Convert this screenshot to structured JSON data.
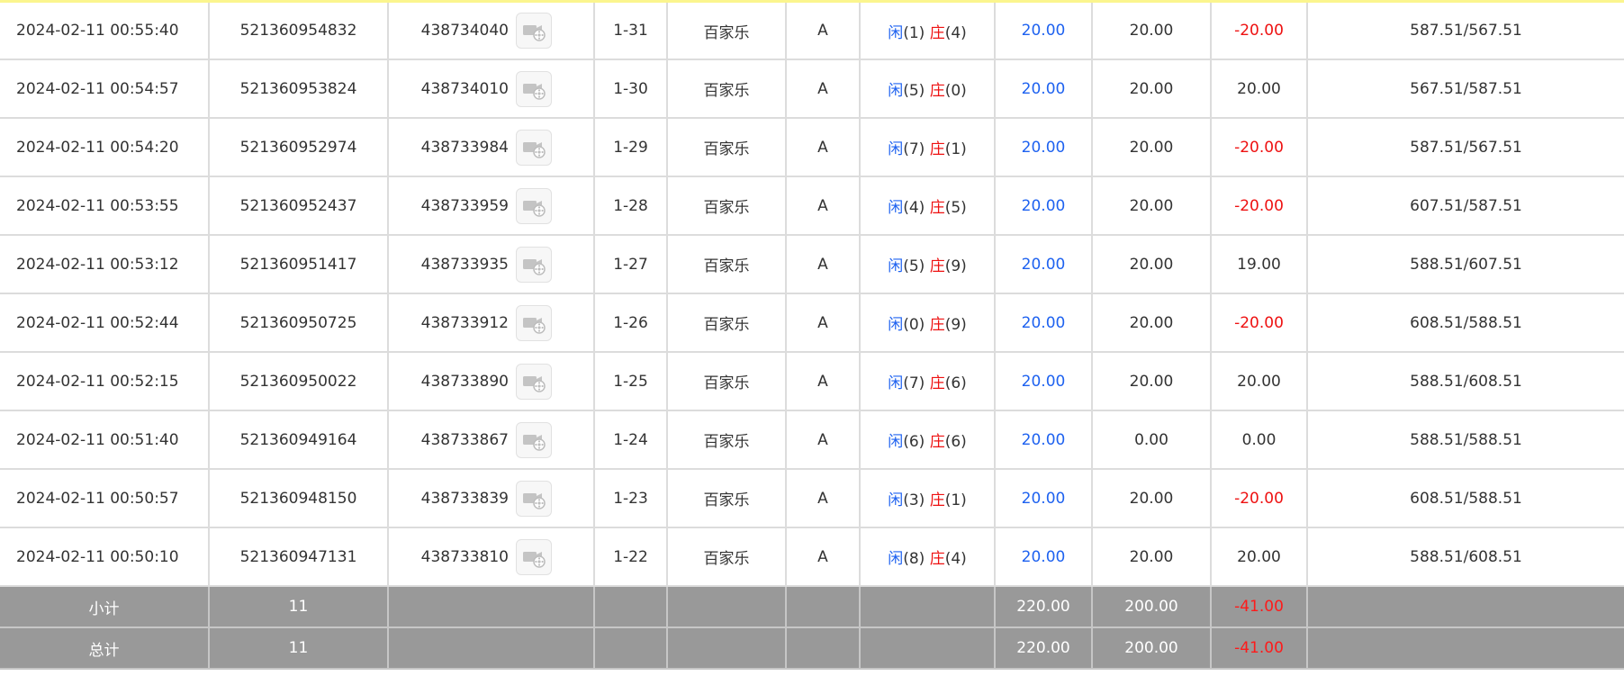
{
  "colors": {
    "player": "#1e62f0",
    "banker": "#ee1111",
    "bet": "#1e62f0",
    "negative": "#ee1111",
    "footer_bg": "#999999"
  },
  "icons": {
    "round_detail": "video-replay-icon"
  },
  "rows": [
    {
      "time": "2024-02-11 00:55:40",
      "bet_no": "521360954832",
      "round_no": "438734040",
      "shoe": "1-31",
      "game": "百家乐",
      "table": "A",
      "player_label": "闲",
      "player_score": "(1)",
      "banker_label": "庄",
      "banker_score": "(4)",
      "bet_amount": "20.00",
      "valid_amount": "20.00",
      "win_loss": "-20.00",
      "negative": true,
      "balance": "587.51/567.51"
    },
    {
      "time": "2024-02-11 00:54:57",
      "bet_no": "521360953824",
      "round_no": "438734010",
      "shoe": "1-30",
      "game": "百家乐",
      "table": "A",
      "player_label": "闲",
      "player_score": "(5)",
      "banker_label": "庄",
      "banker_score": "(0)",
      "bet_amount": "20.00",
      "valid_amount": "20.00",
      "win_loss": "20.00",
      "negative": false,
      "balance": "567.51/587.51"
    },
    {
      "time": "2024-02-11 00:54:20",
      "bet_no": "521360952974",
      "round_no": "438733984",
      "shoe": "1-29",
      "game": "百家乐",
      "table": "A",
      "player_label": "闲",
      "player_score": "(7)",
      "banker_label": "庄",
      "banker_score": "(1)",
      "bet_amount": "20.00",
      "valid_amount": "20.00",
      "win_loss": "-20.00",
      "negative": true,
      "balance": "587.51/567.51"
    },
    {
      "time": "2024-02-11 00:53:55",
      "bet_no": "521360952437",
      "round_no": "438733959",
      "shoe": "1-28",
      "game": "百家乐",
      "table": "A",
      "player_label": "闲",
      "player_score": "(4)",
      "banker_label": "庄",
      "banker_score": "(5)",
      "bet_amount": "20.00",
      "valid_amount": "20.00",
      "win_loss": "-20.00",
      "negative": true,
      "balance": "607.51/587.51"
    },
    {
      "time": "2024-02-11 00:53:12",
      "bet_no": "521360951417",
      "round_no": "438733935",
      "shoe": "1-27",
      "game": "百家乐",
      "table": "A",
      "player_label": "闲",
      "player_score": "(5)",
      "banker_label": "庄",
      "banker_score": "(9)",
      "bet_amount": "20.00",
      "valid_amount": "20.00",
      "win_loss": "19.00",
      "negative": false,
      "balance": "588.51/607.51"
    },
    {
      "time": "2024-02-11 00:52:44",
      "bet_no": "521360950725",
      "round_no": "438733912",
      "shoe": "1-26",
      "game": "百家乐",
      "table": "A",
      "player_label": "闲",
      "player_score": "(0)",
      "banker_label": "庄",
      "banker_score": "(9)",
      "bet_amount": "20.00",
      "valid_amount": "20.00",
      "win_loss": "-20.00",
      "negative": true,
      "balance": "608.51/588.51"
    },
    {
      "time": "2024-02-11 00:52:15",
      "bet_no": "521360950022",
      "round_no": "438733890",
      "shoe": "1-25",
      "game": "百家乐",
      "table": "A",
      "player_label": "闲",
      "player_score": "(7)",
      "banker_label": "庄",
      "banker_score": "(6)",
      "bet_amount": "20.00",
      "valid_amount": "20.00",
      "win_loss": "20.00",
      "negative": false,
      "balance": "588.51/608.51"
    },
    {
      "time": "2024-02-11 00:51:40",
      "bet_no": "521360949164",
      "round_no": "438733867",
      "shoe": "1-24",
      "game": "百家乐",
      "table": "A",
      "player_label": "闲",
      "player_score": "(6)",
      "banker_label": "庄",
      "banker_score": "(6)",
      "bet_amount": "20.00",
      "valid_amount": "0.00",
      "win_loss": "0.00",
      "negative": false,
      "balance": "588.51/588.51"
    },
    {
      "time": "2024-02-11 00:50:57",
      "bet_no": "521360948150",
      "round_no": "438733839",
      "shoe": "1-23",
      "game": "百家乐",
      "table": "A",
      "player_label": "闲",
      "player_score": "(3)",
      "banker_label": "庄",
      "banker_score": "(1)",
      "bet_amount": "20.00",
      "valid_amount": "20.00",
      "win_loss": "-20.00",
      "negative": true,
      "balance": "608.51/588.51"
    },
    {
      "time": "2024-02-11 00:50:10",
      "bet_no": "521360947131",
      "round_no": "438733810",
      "shoe": "1-22",
      "game": "百家乐",
      "table": "A",
      "player_label": "闲",
      "player_score": "(8)",
      "banker_label": "庄",
      "banker_score": "(4)",
      "bet_amount": "20.00",
      "valid_amount": "20.00",
      "win_loss": "20.00",
      "negative": false,
      "balance": "588.51/608.51"
    }
  ],
  "subtotal": {
    "label": "小计",
    "count": "11",
    "bet_amount": "220.00",
    "valid_amount": "200.00",
    "win_loss": "-41.00"
  },
  "total": {
    "label": "总计",
    "count": "11",
    "bet_amount": "220.00",
    "valid_amount": "200.00",
    "win_loss": "-41.00"
  }
}
